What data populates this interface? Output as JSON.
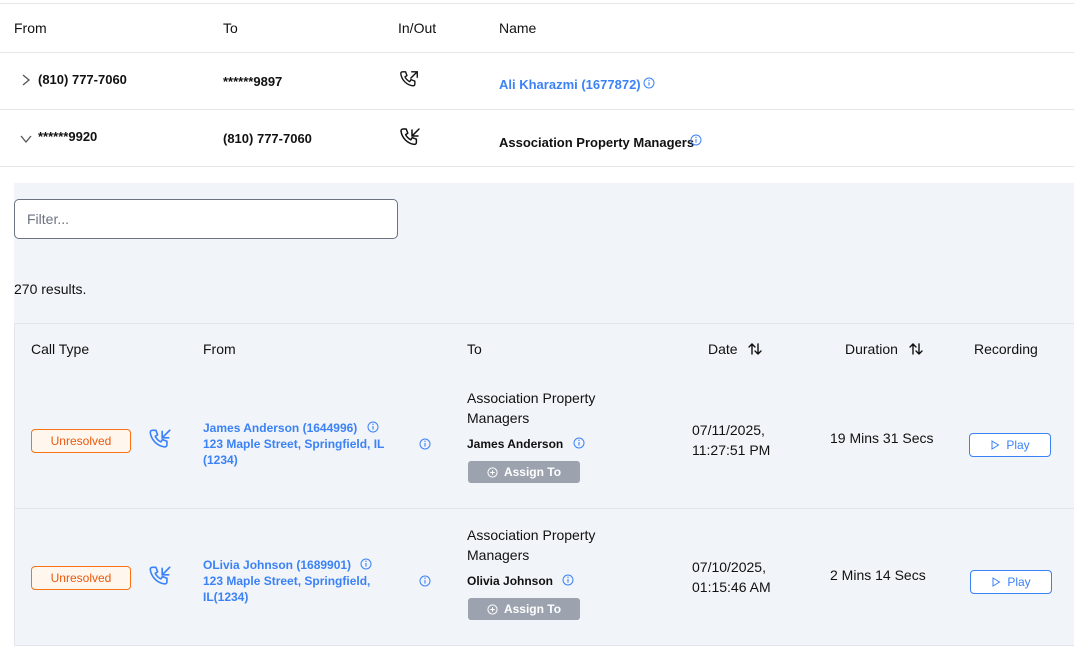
{
  "top_table": {
    "headers": {
      "from": "From",
      "to": "To",
      "inout": "In/Out",
      "name": "Name"
    },
    "rows": [
      {
        "from": "(810) 777-7060",
        "to": "******9897",
        "direction": "outgoing",
        "name": "Ali Kharazmi (1677872)",
        "expanded": false
      },
      {
        "from": "******9920",
        "to": "(810) 777-7060",
        "direction": "incoming",
        "name": "Association Property Managers",
        "expanded": true
      }
    ]
  },
  "filter": {
    "placeholder": "Filter...",
    "value": ""
  },
  "results_text": "270 results.",
  "calls": {
    "headers": {
      "call_type": "Call Type",
      "from": "From",
      "to": "To",
      "date": "Date",
      "duration": "Duration",
      "recording": "Recording"
    },
    "rows": [
      {
        "status": "Unresolved",
        "from_name": "James Anderson (1644996)",
        "from_address": "123 Maple Street, Springfield, IL (1234)",
        "to_org": "Association Property Managers",
        "to_person": "James Anderson",
        "assign_label": "Assign To",
        "date": "07/11/2025, 11:27:51 PM",
        "duration": "19 Mins 31 Secs",
        "play_label": "Play"
      },
      {
        "status": "Unresolved",
        "from_name": "OLivia Johnson (1689901)",
        "from_address": "123 Maple Street, Springfield, IL(1234)",
        "to_org": "Association Property Managers",
        "to_person": "Olivia Johnson",
        "assign_label": "Assign To",
        "date": "07/10/2025, 01:15:46 AM",
        "duration": "2 Mins 14 Secs",
        "play_label": "Play"
      }
    ]
  },
  "colors": {
    "link": "#3b82f6",
    "badge": "#ea580c",
    "panel": "#f1f4f8",
    "assign": "#9ca3af"
  }
}
